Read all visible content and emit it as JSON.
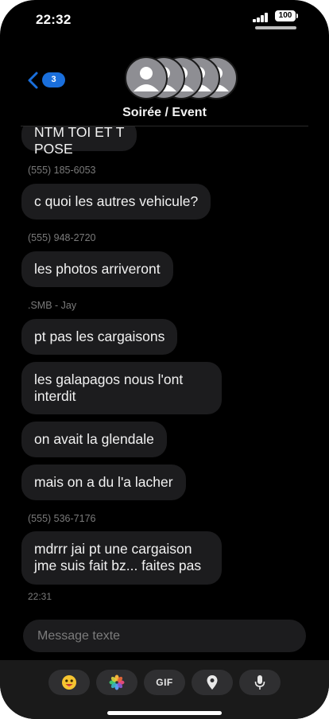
{
  "status_bar": {
    "time": "22:32",
    "battery": "100"
  },
  "header": {
    "unread_count": "3",
    "group_name": "Soirée / Event"
  },
  "messages": [
    {
      "sender": "",
      "text_lines": [
        "NTM TOI ET T",
        "POSE"
      ]
    },
    {
      "sender": "(555) 185-6053",
      "text_lines": [
        "c quoi les autres vehicule?"
      ]
    },
    {
      "sender": "(555) 948-2720",
      "text_lines": [
        "les photos arriveront"
      ]
    },
    {
      "sender": ".SMB - Jay",
      "text_lines": [
        "pt pas les cargaisons"
      ]
    },
    {
      "sender": "",
      "text_lines": [
        "les galapagos nous l'ont",
        "interdit"
      ]
    },
    {
      "sender": "",
      "text_lines": [
        "on avait la glendale"
      ]
    },
    {
      "sender": "",
      "text_lines": [
        "mais on a du l'a lacher"
      ]
    },
    {
      "sender": "(555) 536-7176",
      "text_lines": [
        "mdrrr jai pt une cargaison",
        "jme suis fait bz... faites pas"
      ]
    }
  ],
  "timestamp": "22:31",
  "composer": {
    "placeholder": "Message texte"
  },
  "app_bar": {
    "gif_label": "GIF",
    "apps": [
      "memoji-icon",
      "photos-icon",
      "gif-button",
      "location-pin-icon",
      "microphone-icon"
    ]
  },
  "colors": {
    "background": "#000000",
    "bubble": "#1c1c1e",
    "accent": "#1a6fdc"
  }
}
